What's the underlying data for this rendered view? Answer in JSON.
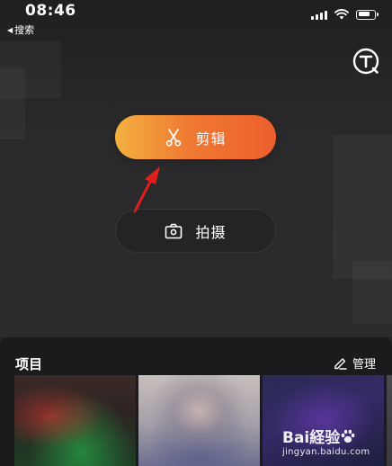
{
  "status_bar": {
    "time": "08:46",
    "back_label": "搜索",
    "signal_bars": 4,
    "battery_level": 0.8
  },
  "main": {
    "edit_button_label": "剪辑",
    "shoot_button_label": "拍摄"
  },
  "projects": {
    "title": "项目",
    "manage_label": "管理",
    "thumbnails": [
      {
        "name": "project-thumbnail-1"
      },
      {
        "name": "project-thumbnail-2"
      },
      {
        "name": "project-thumbnail-3"
      },
      {
        "name": "project-thumbnail-4"
      }
    ]
  },
  "watermark": {
    "logo_text": "Bai経验",
    "url": "jingyan.baidu.com"
  },
  "icons": {
    "back": "back-caret-icon",
    "signal": "cellular-signal-icon",
    "wifi": "wifi-icon",
    "battery": "battery-icon",
    "text_tool": "text-circle-icon",
    "edit": "scissors-icon",
    "shoot": "camera-icon",
    "manage": "pencil-icon",
    "annotation": "red-arrow-icon",
    "watermark_paw": "paw-icon"
  },
  "colors": {
    "edit_gradient_start": "#f3b13f",
    "edit_gradient_end": "#ec5f2d",
    "annotation_red": "#e0201b",
    "background": "#232325",
    "panel": "#1b1b1d"
  }
}
